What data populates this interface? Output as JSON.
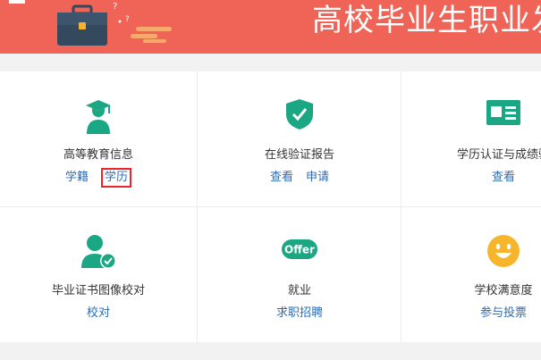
{
  "colors": {
    "banner": "#ef6456",
    "green": "#1ba784",
    "link": "#2b6cb6",
    "highlight": "#e8262b",
    "smiley": "#f7b52c"
  },
  "header": {
    "title": "高校毕业生职业发"
  },
  "services": [
    {
      "icon": "graduate-icon",
      "title": "高等教育信息",
      "links": [
        "学籍",
        "学历"
      ],
      "highlighted_link": "学历"
    },
    {
      "icon": "shield-check-icon",
      "title": "在线验证报告",
      "links": [
        "查看",
        "申请"
      ]
    },
    {
      "icon": "id-card-icon",
      "title": "学历认证与成绩验",
      "links": [
        "查看"
      ]
    },
    {
      "icon": "user-check-icon",
      "title": "毕业证书图像校对",
      "links": [
        "校对"
      ]
    },
    {
      "icon": "offer-icon",
      "icon_text": "Offer",
      "title": "就业",
      "links": [
        "求职招聘"
      ]
    },
    {
      "icon": "smiley-icon",
      "title": "学校满意度",
      "links": [
        "参与投票"
      ]
    }
  ]
}
